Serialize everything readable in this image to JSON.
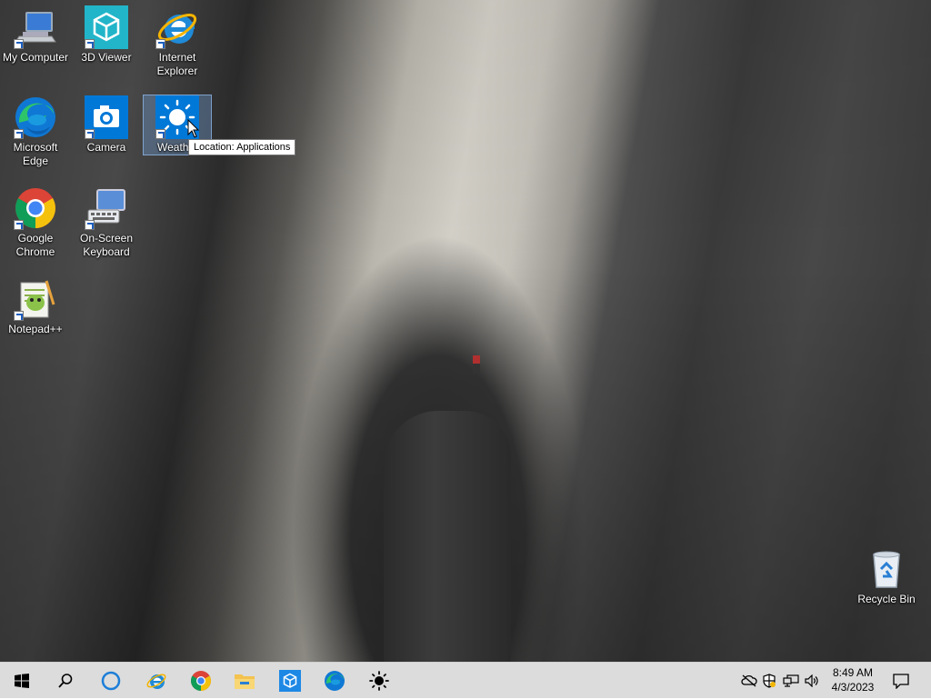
{
  "desktop": {
    "icons": [
      {
        "label": "My Computer",
        "icon": "computer-icon"
      },
      {
        "label": "3D Viewer",
        "icon": "cube-icon"
      },
      {
        "label": "Internet Explorer",
        "icon": "internet-explorer-icon"
      },
      {
        "label": "Microsoft Edge",
        "icon": "edge-icon"
      },
      {
        "label": "Camera",
        "icon": "camera-icon"
      },
      {
        "label": "Weath",
        "icon": "weather-sun-icon"
      },
      {
        "label": "Google Chrome",
        "icon": "chrome-icon"
      },
      {
        "label": "On-Screen Keyboard",
        "icon": "keyboard-icon"
      },
      {
        "label": "Notepad++",
        "icon": "notepad-plus-plus-icon"
      },
      {
        "label": "Recycle Bin",
        "icon": "recycle-bin-icon"
      }
    ],
    "tooltip": "Location: Applications"
  },
  "taskbar": {
    "buttons": [
      "start-icon",
      "search-icon",
      "cortana-icon",
      "internet-explorer-icon",
      "chrome-icon",
      "file-explorer-icon",
      "3d-viewer-icon",
      "edge-icon",
      "weather-sun-icon"
    ],
    "tray": [
      "onedrive-offline-icon",
      "security-shield-icon",
      "network-icon",
      "volume-icon"
    ],
    "clock": {
      "time": "8:49 AM",
      "date": "4/3/2023"
    },
    "notifications": "action-center-icon"
  },
  "colors": {
    "taskbar_bg": "#dcdcdc",
    "selection": "#78aae6",
    "accent_blue": "#0078d7"
  }
}
